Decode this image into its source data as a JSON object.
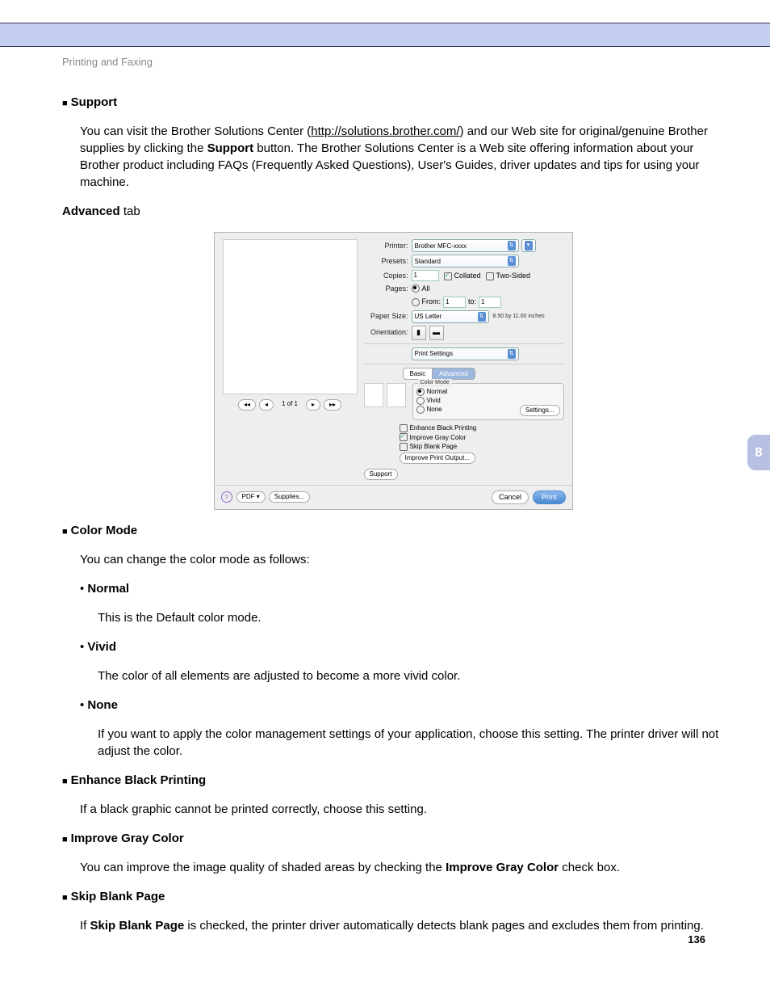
{
  "breadcrumb": "Printing and Faxing",
  "chapter": "8",
  "page_number": "136",
  "sections": {
    "support": {
      "title": "Support",
      "text1": "You can visit the Brother Solutions Center (",
      "url": "http://solutions.brother.com/",
      "text2": ") and our Web site for original/genuine Brother supplies by clicking the ",
      "button_word": "Support",
      "text3": " button. The Brother Solutions Center is a Web site offering information about your Brother product including FAQs (Frequently Asked Questions), User's Guides, driver updates and tips for using your machine."
    },
    "advanced_tab": "Advanced tab",
    "color_mode": {
      "title": "Color Mode",
      "intro": "You can change the color mode as follows:",
      "normal": {
        "label": "Normal",
        "text": "This is the Default color mode."
      },
      "vivid": {
        "label": "Vivid",
        "text": "The color of all elements are adjusted to become a more vivid color."
      },
      "none": {
        "label": "None",
        "text": "If you want to apply the color management settings of your application, choose this setting. The printer driver will not adjust the color."
      }
    },
    "enhance_black": {
      "title": "Enhance Black Printing",
      "text": "If a black graphic cannot be printed correctly, choose this setting."
    },
    "improve_gray": {
      "title": "Improve Gray Color",
      "text1": "You can improve the image quality of shaded areas by checking the ",
      "bold": "Improve Gray Color",
      "text2": " check box."
    },
    "skip_blank": {
      "title": "Skip Blank Page",
      "text1": "If ",
      "bold": "Skip Blank Page",
      "text2": " is checked, the printer driver automatically detects blank pages and excludes them from printing."
    }
  },
  "dialog": {
    "printer_label": "Printer:",
    "printer_value": "Brother MFC-xxxx",
    "presets_label": "Presets:",
    "presets_value": "Standard",
    "copies_label": "Copies:",
    "copies_value": "1",
    "collated": "Collated",
    "two_sided": "Two-Sided",
    "pages_label": "Pages:",
    "all": "All",
    "from": "From:",
    "from_value": "1",
    "to": "to:",
    "to_value": "1",
    "paper_size_label": "Paper Size:",
    "paper_size_value": "US Letter",
    "paper_dim": "8.50 by 11.00 inches",
    "orientation_label": "Orientation:",
    "section_select": "Print Settings",
    "tab_basic": "Basic",
    "tab_advanced": "Advanced",
    "group_title": "Color Mode",
    "opt_normal": "Normal",
    "opt_vivid": "Vivid",
    "opt_none": "None",
    "settings_btn": "Settings...",
    "chk_enhance": "Enhance Black Printing",
    "chk_gray": "Improve Gray Color",
    "chk_skip": "Skip Blank Page",
    "improve_output_btn": "Improve Print Output...",
    "support_btn": "Support",
    "page_nav": "1 of 1",
    "help": "?",
    "pdf": "PDF ▾",
    "supplies": "Supplies...",
    "cancel": "Cancel",
    "print": "Print"
  }
}
